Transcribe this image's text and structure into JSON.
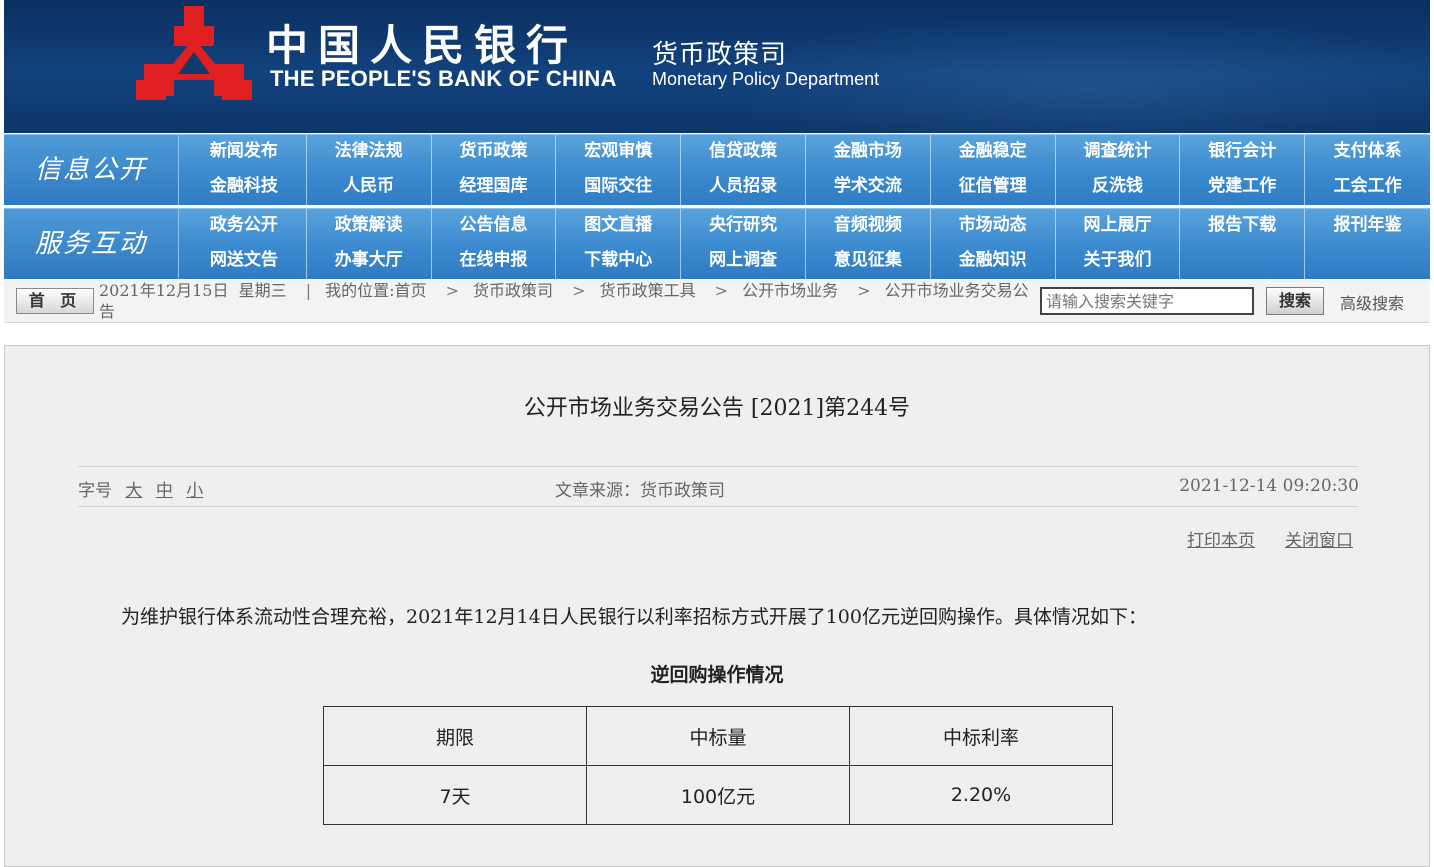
{
  "header": {
    "bank_name_cn": "中国人民银行",
    "bank_name_en": "THE PEOPLE'S BANK OF CHINA",
    "dept_name_cn": "货币政策司",
    "dept_name_en": "Monetary Policy Department",
    "logo_color": "#e02020",
    "bg_color": "#0f3a6e"
  },
  "nav": {
    "info_title": "信息公开",
    "info_items": [
      "新闻发布",
      "法律法规",
      "货币政策",
      "宏观审慎",
      "信贷政策",
      "金融市场",
      "金融稳定",
      "调查统计",
      "银行会计",
      "支付体系",
      "金融科技",
      "人民币",
      "经理国库",
      "国际交往",
      "人员招录",
      "学术交流",
      "征信管理",
      "反洗钱",
      "党建工作",
      "工会工作"
    ],
    "service_title": "服务互动",
    "service_items": [
      "政务公开",
      "政策解读",
      "公告信息",
      "图文直播",
      "央行研究",
      "音频视频",
      "市场动态",
      "网上展厅",
      "报告下载",
      "报刊年鉴",
      "网送文告",
      "办事大厅",
      "在线申报",
      "下载中心",
      "网上调查",
      "意见征集",
      "金融知识",
      "关于我们"
    ],
    "accent_color": "#3d8bd0"
  },
  "breadcrumb": {
    "home_label": "首 页",
    "date": "2021年12月15日",
    "weekday": "星期三",
    "location_prefix": "我的位置:",
    "path": [
      "首页",
      "货币政策司",
      "货币政策工具",
      "公开市场业务",
      "公开市场业务交易公告"
    ],
    "search_placeholder": "请输入搜索关键字",
    "search_button": "搜索",
    "advanced_search": "高级搜索"
  },
  "article": {
    "title": "公开市场业务交易公告 [2021]第244号",
    "font_size_label": "字号",
    "font_sizes": [
      "大",
      "中",
      "小"
    ],
    "source": "文章来源：货币政策司",
    "datetime": "2021-12-14 09:20:30",
    "print_label": "打印本页",
    "close_label": "关闭窗口",
    "intro": "为维护银行体系流动性合理充裕，2021年12月14日人民银行以利率招标方式开展了100亿元逆回购操作。具体情况如下：",
    "table_title": "逆回购操作情况",
    "table": {
      "headers": [
        "期限",
        "中标量",
        "中标利率"
      ],
      "rows": [
        [
          "7天",
          "100亿元",
          "2.20%"
        ]
      ]
    }
  }
}
